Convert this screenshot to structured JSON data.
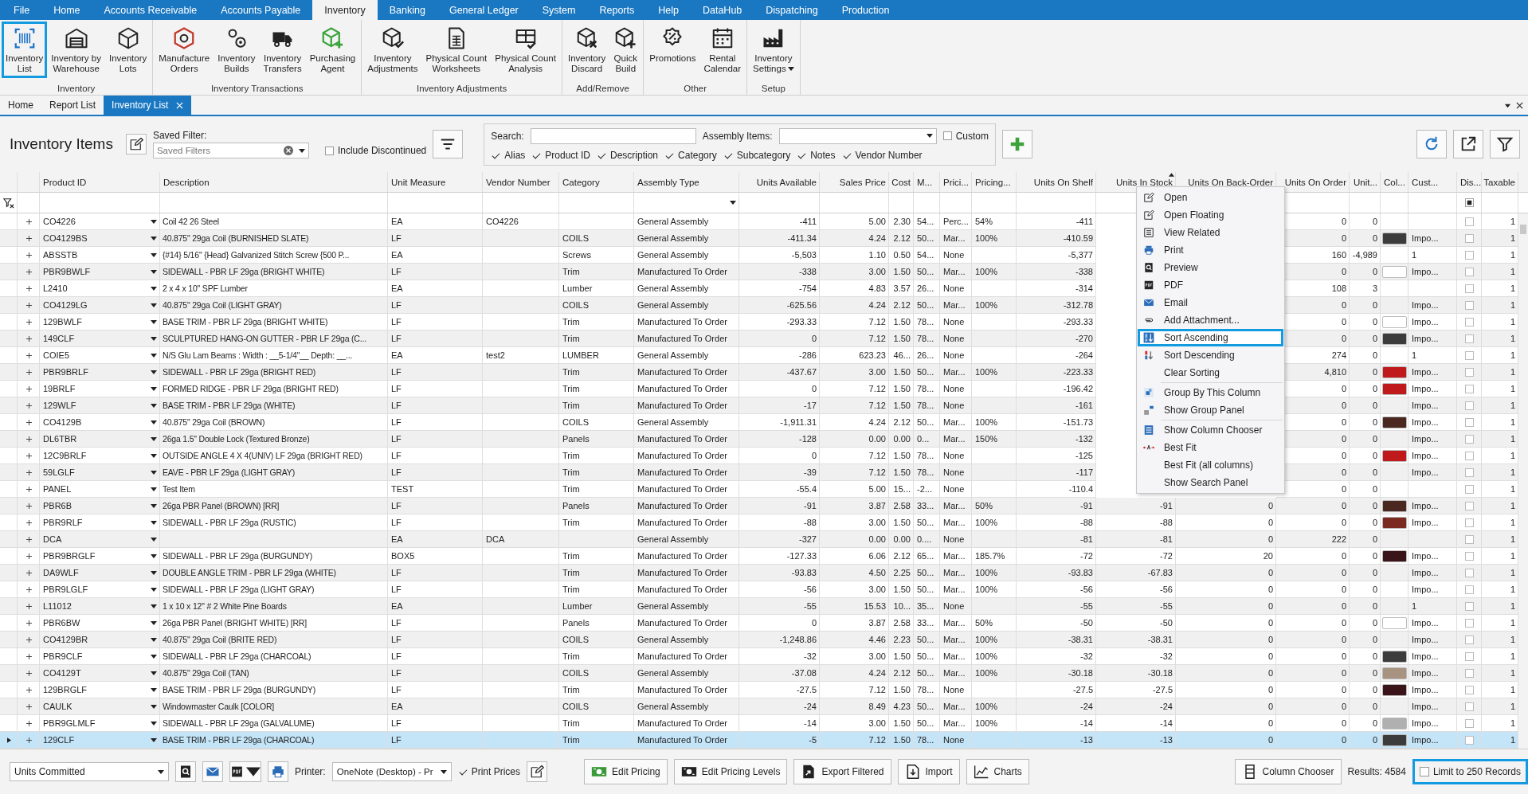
{
  "menu_tabs": [
    {
      "label": "File",
      "selected": false
    },
    {
      "label": "Home",
      "selected": false
    },
    {
      "label": "Accounts Receivable",
      "selected": false
    },
    {
      "label": "Accounts Payable",
      "selected": false
    },
    {
      "label": "Inventory",
      "selected": true
    },
    {
      "label": "Banking",
      "selected": false
    },
    {
      "label": "General Ledger",
      "selected": false
    },
    {
      "label": "System",
      "selected": false
    },
    {
      "label": "Reports",
      "selected": false
    },
    {
      "label": "Help",
      "selected": false
    },
    {
      "label": "DataHub",
      "selected": false
    },
    {
      "label": "Dispatching",
      "selected": false
    },
    {
      "label": "Production",
      "selected": false
    }
  ],
  "ribbon": [
    {
      "label": "Inventory",
      "buttons": [
        {
          "lines": [
            "Inventory",
            "List"
          ],
          "selected": true
        },
        {
          "lines": [
            "Inventory by",
            "Warehouse"
          ],
          "selected": false
        },
        {
          "lines": [
            "Inventory",
            "Lots"
          ],
          "selected": false
        }
      ]
    },
    {
      "label": "Inventory Transactions",
      "buttons": [
        {
          "lines": [
            "Manufacture",
            "Orders"
          ],
          "selected": false
        },
        {
          "lines": [
            "Inventory",
            "Builds"
          ],
          "selected": false
        },
        {
          "lines": [
            "Inventory",
            "Transfers"
          ],
          "selected": false
        },
        {
          "lines": [
            "Purchasing",
            "Agent"
          ],
          "selected": false
        }
      ]
    },
    {
      "label": "Inventory Adjustments",
      "buttons": [
        {
          "lines": [
            "Inventory",
            "Adjustments"
          ],
          "selected": false
        },
        {
          "lines": [
            "Physical Count",
            "Worksheets"
          ],
          "selected": false
        },
        {
          "lines": [
            "Physical Count",
            "Analysis"
          ],
          "selected": false
        }
      ]
    },
    {
      "label": "Add/Remove",
      "buttons": [
        {
          "lines": [
            "Inventory",
            "Discard"
          ],
          "selected": false
        },
        {
          "lines": [
            "Quick",
            "Build"
          ],
          "selected": false
        }
      ]
    },
    {
      "label": "Other",
      "buttons": [
        {
          "lines": [
            "Promotions"
          ],
          "selected": false
        },
        {
          "lines": [
            "Rental",
            "Calendar"
          ],
          "selected": false
        }
      ]
    },
    {
      "label": "Setup",
      "buttons": [
        {
          "lines": [
            "Inventory",
            "Settings"
          ],
          "selected": false,
          "dropdown": true
        }
      ]
    }
  ],
  "doc_tabs": [
    {
      "label": "Home",
      "selected": false
    },
    {
      "label": "Report List",
      "selected": false
    },
    {
      "label": "Inventory List",
      "selected": true
    }
  ],
  "toolbar": {
    "title": "Inventory Items",
    "saved_filter_label": "Saved Filter:",
    "saved_filter": {
      "placeholder": "Saved Filters"
    },
    "include_discontinued": {
      "label": "Include Discontinued",
      "checked": false
    },
    "search_label": "Search:",
    "assembly_label": "Assembly Items:",
    "custom": {
      "label": "Custom",
      "checked": false
    },
    "search_fields": [
      {
        "label": "Alias",
        "checked": true
      },
      {
        "label": "Product ID",
        "checked": true
      },
      {
        "label": "Description",
        "checked": true
      },
      {
        "label": "Category",
        "checked": true
      },
      {
        "label": "Subcategory",
        "checked": true
      },
      {
        "label": "Notes",
        "checked": true
      },
      {
        "label": "Vendor Number",
        "checked": true
      }
    ]
  },
  "table": {
    "columns": [
      {
        "label": "Product ID",
        "kind": "drop",
        "sorted": false
      },
      {
        "label": "Description",
        "kind": "desc",
        "sorted": false
      },
      {
        "label": "Unit Measure",
        "kind": "text",
        "sorted": false
      },
      {
        "label": "Vendor Number",
        "kind": "text",
        "sorted": false
      },
      {
        "label": "Category",
        "kind": "text",
        "sorted": false
      },
      {
        "label": "Assembly Type",
        "kind": "text",
        "sorted": false
      },
      {
        "label": "Units Available",
        "kind": "num",
        "sorted": false
      },
      {
        "label": "Sales Price",
        "kind": "num",
        "sorted": false
      },
      {
        "label": "Cost",
        "kind": "num",
        "sorted": false
      },
      {
        "label": "M...",
        "kind": "text",
        "sorted": false
      },
      {
        "label": "Prici...",
        "kind": "text",
        "sorted": false
      },
      {
        "label": "Pricing...",
        "kind": "text",
        "sorted": false
      },
      {
        "label": "Units On Shelf",
        "kind": "num",
        "sorted": false
      },
      {
        "label": "Units In Stock",
        "kind": "num",
        "sorted": true
      },
      {
        "label": "Units On Back-Order",
        "kind": "num",
        "sorted": false
      },
      {
        "label": "Units On Order",
        "kind": "num",
        "sorted": false
      },
      {
        "label": "Unit...",
        "kind": "num",
        "sorted": false
      },
      {
        "label": "Col...",
        "kind": "swatch",
        "sorted": false
      },
      {
        "label": "Cust...",
        "kind": "text",
        "sorted": false
      },
      {
        "label": "Dis...",
        "kind": "check",
        "sorted": false
      },
      {
        "label": "Taxable",
        "kind": "num",
        "sorted": false
      }
    ],
    "rows": [
      {
        "cells": [
          "CO4226",
          "Coil 42 26 Steel",
          "EA",
          "CO4226",
          null,
          "General Assembly",
          "-411",
          "5.00",
          "2.30",
          "54...",
          "Perc...",
          "54%",
          "-411",
          null,
          null,
          "0",
          "0",
          null,
          null,
          null,
          "1"
        ],
        "discontinued": false,
        "selected": false
      },
      {
        "cells": [
          "CO4129BS",
          "40.875\" 29ga Coil (BURNISHED SLATE)",
          "LF",
          null,
          "COILS",
          "General Assembly",
          "-411.34",
          "4.24",
          "2.12",
          "50...",
          "Mar...",
          "100%",
          "-410.59",
          null,
          null,
          "0",
          "0",
          null,
          "Impo...",
          null,
          "1"
        ],
        "color": "#3c3c3c",
        "discontinued": false,
        "selected": false
      },
      {
        "cells": [
          "ABSSTB",
          "{#14} 5/16\" {Head} Galvanized Stitch Screw {500 P...",
          "EA",
          null,
          "Screws",
          "General Assembly",
          "-5,503",
          "1.10",
          "0.50",
          "54...",
          "None",
          null,
          "-5,377",
          null,
          null,
          "160",
          "-4,989",
          null,
          "1",
          null,
          "1"
        ],
        "discontinued": false,
        "selected": false
      },
      {
        "cells": [
          "PBR9BWLF",
          "SIDEWALL - PBR LF 29ga (BRIGHT WHITE)",
          "LF",
          null,
          "Trim",
          "Manufactured To Order",
          "-338",
          "3.00",
          "1.50",
          "50...",
          "Mar...",
          "100%",
          "-338",
          null,
          null,
          "0",
          "0",
          null,
          "Impo...",
          null,
          "1"
        ],
        "color": "#ffffff",
        "discontinued": false,
        "selected": false
      },
      {
        "cells": [
          "L2410",
          "2 x 4 x 10'' SPF Lumber",
          "EA",
          null,
          "Lumber",
          "General Assembly",
          "-754",
          "4.83",
          "3.57",
          "26...",
          "None",
          null,
          "-314",
          null,
          null,
          "108",
          "3",
          null,
          null,
          null,
          "1"
        ],
        "discontinued": false,
        "selected": false
      },
      {
        "cells": [
          "CO4129LG",
          "40.875\" 29ga Coil (LIGHT GRAY)",
          "LF",
          null,
          "COILS",
          "General Assembly",
          "-625.56",
          "4.24",
          "2.12",
          "50...",
          "Mar...",
          "100%",
          "-312.78",
          null,
          null,
          "0",
          "0",
          null,
          "Impo...",
          null,
          "1"
        ],
        "discontinued": false,
        "selected": false
      },
      {
        "cells": [
          "129BWLF",
          "BASE TRIM - PBR LF 29ga (BRIGHT WHITE)",
          "LF",
          null,
          "Trim",
          "Manufactured To Order",
          "-293.33",
          "7.12",
          "1.50",
          "78...",
          "None",
          null,
          "-293.33",
          null,
          null,
          "0",
          "0",
          null,
          "Impo...",
          null,
          "1"
        ],
        "color": "#ffffff",
        "discontinued": false,
        "selected": false
      },
      {
        "cells": [
          "149CLF",
          "SCULPTURED HANG-ON GUTTER - PBR LF 29ga (C...",
          "LF",
          null,
          "Trim",
          "Manufactured To Order",
          "0",
          "7.12",
          "1.50",
          "78...",
          "None",
          null,
          "-270",
          null,
          null,
          "0",
          "0",
          null,
          "Impo...",
          null,
          "1"
        ],
        "color": "#3c3c3c",
        "discontinued": false,
        "selected": false
      },
      {
        "cells": [
          "COIE5",
          "N/S Glu Lam Beams : Width : __5-1/4\"__ Depth: __...",
          "EA",
          "test2",
          "LUMBER",
          "General Assembly",
          "-286",
          "623.23",
          "46...",
          "26...",
          "None",
          null,
          "-264",
          null,
          null,
          "274",
          "0",
          null,
          "1",
          null,
          "1"
        ],
        "discontinued": false,
        "selected": false
      },
      {
        "cells": [
          "PBR9BRLF",
          "SIDEWALL - PBR LF 29ga (BRIGHT RED)",
          "LF",
          null,
          "Trim",
          "Manufactured To Order",
          "-437.67",
          "3.00",
          "1.50",
          "50...",
          "Mar...",
          "100%",
          "-223.33",
          null,
          null,
          "4,810",
          "0",
          null,
          "Impo...",
          null,
          "1"
        ],
        "color": "#c0191c",
        "discontinued": false,
        "selected": false
      },
      {
        "cells": [
          "19BRLF",
          "FORMED RIDGE - PBR LF 29ga (BRIGHT RED)",
          "LF",
          null,
          "Trim",
          "Manufactured To Order",
          "0",
          "7.12",
          "1.50",
          "78...",
          "None",
          null,
          "-196.42",
          null,
          null,
          "0",
          "0",
          null,
          "Impo...",
          null,
          "1"
        ],
        "color": "#c0191c",
        "discontinued": false,
        "selected": false
      },
      {
        "cells": [
          "129WLF",
          "BASE TRIM - PBR LF 29ga (WHITE)",
          "LF",
          null,
          "Trim",
          "Manufactured To Order",
          "-17",
          "7.12",
          "1.50",
          "78...",
          "None",
          null,
          "-161",
          null,
          null,
          "0",
          "0",
          null,
          "Impo...",
          null,
          "1"
        ],
        "discontinued": false,
        "selected": false
      },
      {
        "cells": [
          "CO4129B",
          "40.875\" 29ga Coil (BROWN)",
          "LF",
          null,
          "COILS",
          "General Assembly",
          "-1,911.31",
          "4.24",
          "2.12",
          "50...",
          "Mar...",
          "100%",
          "-151.73",
          null,
          null,
          "0",
          "0",
          null,
          "Impo...",
          null,
          "1"
        ],
        "color": "#4a2820",
        "discontinued": false,
        "selected": false
      },
      {
        "cells": [
          "DL6TBR",
          "26ga 1.5\" Double Lock (Textured Bronze)",
          "LF",
          null,
          "Panels",
          "Manufactured To Order",
          "-128",
          "0.00",
          "0.00",
          "0...",
          "Mar...",
          "150%",
          "-132",
          null,
          null,
          "0",
          "0",
          null,
          "Impo...",
          null,
          "1"
        ],
        "discontinued": false,
        "selected": false
      },
      {
        "cells": [
          "12C9BRLF",
          "OUTSIDE ANGLE  4 X 4(UNIV) LF 29ga (BRIGHT RED)",
          "LF",
          null,
          "Trim",
          "Manufactured To Order",
          "0",
          "7.12",
          "1.50",
          "78...",
          "None",
          null,
          "-125",
          null,
          null,
          "0",
          "0",
          null,
          "Impo...",
          null,
          "1"
        ],
        "color": "#c0191c",
        "discontinued": false,
        "selected": false
      },
      {
        "cells": [
          "59LGLF",
          "EAVE - PBR LF 29ga (LIGHT GRAY)",
          "LF",
          null,
          "Trim",
          "Manufactured To Order",
          "-39",
          "7.12",
          "1.50",
          "78...",
          "None",
          null,
          "-117",
          null,
          null,
          "0",
          "0",
          null,
          "Impo...",
          null,
          "1"
        ],
        "discontinued": false,
        "selected": false
      },
      {
        "cells": [
          "PANEL",
          "Test Item",
          "TEST",
          null,
          "Trim",
          "Manufactured To Order",
          "-55.4",
          "5.00",
          "15...",
          "-2...",
          "None",
          null,
          "-110.4",
          null,
          null,
          "0",
          "0",
          null,
          null,
          null,
          "1"
        ],
        "discontinued": false,
        "selected": false
      },
      {
        "cells": [
          "PBR6B",
          "26ga PBR Panel (BROWN) [RR]",
          "LF",
          null,
          "Panels",
          "Manufactured To Order",
          "-91",
          "3.87",
          "2.58",
          "33...",
          "Mar...",
          "50%",
          "-91",
          "-91",
          "0",
          "0",
          "0",
          null,
          "Impo...",
          null,
          "1"
        ],
        "color": "#4a2820",
        "discontinued": false,
        "selected": false
      },
      {
        "cells": [
          "PBR9RLF",
          "SIDEWALL - PBR LF 29ga (RUSTIC)",
          "LF",
          null,
          "Trim",
          "Manufactured To Order",
          "-88",
          "3.00",
          "1.50",
          "50...",
          "Mar...",
          "100%",
          "-88",
          "-88",
          "0",
          "0",
          "0",
          null,
          "Impo...",
          null,
          "1"
        ],
        "color": "#7a2a1e",
        "discontinued": false,
        "selected": false
      },
      {
        "cells": [
          "DCA",
          null,
          "EA",
          "DCA",
          null,
          "General Assembly",
          "-327",
          "0.00",
          "0.00",
          "0....",
          "None",
          null,
          "-81",
          "-81",
          "0",
          "222",
          "0",
          null,
          null,
          null,
          "1"
        ],
        "discontinued": false,
        "selected": false
      },
      {
        "cells": [
          "PBR9BRGLF",
          "SIDEWALL - PBR LF 29ga (BURGUNDY)",
          "BOX5",
          null,
          "Trim",
          "Manufactured To Order",
          "-127.33",
          "6.06",
          "2.12",
          "65...",
          "Mar...",
          "185.7%",
          "-72",
          "-72",
          "20",
          "0",
          "0",
          null,
          "Impo...",
          null,
          "1"
        ],
        "color": "#3a1418",
        "discontinued": false,
        "selected": false
      },
      {
        "cells": [
          "DA9WLF",
          "DOUBLE ANGLE TRIM - PBR LF 29ga (WHITE)",
          "LF",
          null,
          "Trim",
          "Manufactured To Order",
          "-93.83",
          "4.50",
          "2.25",
          "50...",
          "Mar...",
          "100%",
          "-93.83",
          "-67.83",
          "0",
          "0",
          "0",
          null,
          "Impo...",
          null,
          "1"
        ],
        "discontinued": false,
        "selected": false
      },
      {
        "cells": [
          "PBR9LGLF",
          "SIDEWALL - PBR LF 29ga (LIGHT GRAY)",
          "LF",
          null,
          "Trim",
          "Manufactured To Order",
          "-56",
          "3.00",
          "1.50",
          "50...",
          "Mar...",
          "100%",
          "-56",
          "-56",
          "0",
          "0",
          "0",
          null,
          "Impo...",
          null,
          "1"
        ],
        "discontinued": false,
        "selected": false
      },
      {
        "cells": [
          "L11012",
          "1 x 10 x 12'' # 2 White Pine Boards",
          "EA",
          null,
          "Lumber",
          "General Assembly",
          "-55",
          "15.53",
          "10...",
          "35...",
          "None",
          null,
          "-55",
          "-55",
          "0",
          "0",
          "0",
          null,
          "1",
          null,
          "1"
        ],
        "discontinued": false,
        "selected": false
      },
      {
        "cells": [
          "PBR6BW",
          "26ga PBR Panel (BRIGHT WHITE) [RR]",
          "LF",
          null,
          "Panels",
          "Manufactured To Order",
          "0",
          "3.87",
          "2.58",
          "33...",
          "Mar...",
          "50%",
          "-50",
          "-50",
          "0",
          "0",
          "0",
          null,
          "Impo...",
          null,
          "1"
        ],
        "color": "#ffffff",
        "discontinued": false,
        "selected": false
      },
      {
        "cells": [
          "CO4129BR",
          "40.875\" 29ga Coil (BRITE RED)",
          "LF",
          null,
          "COILS",
          "General Assembly",
          "-1,248.86",
          "4.46",
          "2.23",
          "50...",
          "Mar...",
          "100%",
          "-38.31",
          "-38.31",
          "0",
          "0",
          "0",
          null,
          "Impo...",
          null,
          "1"
        ],
        "discontinued": false,
        "selected": false
      },
      {
        "cells": [
          "PBR9CLF",
          "SIDEWALL - PBR LF 29ga (CHARCOAL)",
          "LF",
          null,
          "Trim",
          "Manufactured To Order",
          "-32",
          "3.00",
          "1.50",
          "50...",
          "Mar...",
          "100%",
          "-32",
          "-32",
          "0",
          "0",
          "0",
          null,
          "Impo...",
          null,
          "1"
        ],
        "color": "#3c3c3c",
        "discontinued": false,
        "selected": false
      },
      {
        "cells": [
          "CO4129T",
          "40.875\" 29ga Coil (TAN)",
          "LF",
          null,
          "COILS",
          "General Assembly",
          "-37.08",
          "4.24",
          "2.12",
          "50...",
          "Mar...",
          "100%",
          "-30.18",
          "-30.18",
          "0",
          "0",
          "0",
          null,
          "Impo...",
          null,
          "1"
        ],
        "color": "#a89280",
        "discontinued": false,
        "selected": false
      },
      {
        "cells": [
          "129BRGLF",
          "BASE TRIM - PBR LF 29ga (BURGUNDY)",
          "LF",
          null,
          "Trim",
          "Manufactured To Order",
          "-27.5",
          "7.12",
          "1.50",
          "78...",
          "None",
          null,
          "-27.5",
          "-27.5",
          "0",
          "0",
          "0",
          null,
          "Impo...",
          null,
          "1"
        ],
        "color": "#3a1418",
        "discontinued": false,
        "selected": false
      },
      {
        "cells": [
          "CAULK",
          "Windowmaster Caulk [COLOR]",
          "EA",
          null,
          "COILS",
          "General Assembly",
          "-24",
          "8.49",
          "4.23",
          "50...",
          "Mar...",
          "100%",
          "-24",
          "-24",
          "0",
          "0",
          "0",
          null,
          "Impo...",
          null,
          "1"
        ],
        "discontinued": false,
        "selected": false
      },
      {
        "cells": [
          "PBR9GLMLF",
          "SIDEWALL - PBR LF 29ga (GALVALUME)",
          "LF",
          null,
          "Trim",
          "Manufactured To Order",
          "-14",
          "3.00",
          "1.50",
          "50...",
          "Mar...",
          "100%",
          "-14",
          "-14",
          "0",
          "0",
          "0",
          null,
          "Impo...",
          null,
          "1"
        ],
        "color": "#b0b0b0",
        "discontinued": false,
        "selected": false
      },
      {
        "cells": [
          "129CLF",
          "BASE TRIM - PBR LF 29ga (CHARCOAL)",
          "LF",
          null,
          "Trim",
          "Manufactured To Order",
          "-5",
          "7.12",
          "1.50",
          "78...",
          "None",
          null,
          "-13",
          "-13",
          "0",
          "0",
          "0",
          null,
          "Impo...",
          null,
          "1"
        ],
        "color": "#3c3c3c",
        "discontinued": false,
        "selected": true
      }
    ]
  },
  "context_menu": [
    [
      {
        "label": "Open",
        "selected": false
      },
      {
        "label": "Open Floating",
        "selected": false
      },
      {
        "label": "View Related",
        "selected": false
      },
      {
        "label": "Print",
        "selected": false
      },
      {
        "label": "Preview",
        "selected": false
      },
      {
        "label": "PDF",
        "selected": false
      },
      {
        "label": "Email",
        "selected": false
      },
      {
        "label": "Add Attachment...",
        "selected": false
      },
      {
        "label": "Sort Ascending",
        "selected": true
      },
      {
        "label": "Sort Descending",
        "selected": false
      },
      {
        "label": "Clear Sorting",
        "selected": false
      }
    ],
    [
      {
        "label": "Group By This Column",
        "selected": false
      },
      {
        "label": "Show Group Panel",
        "selected": false
      }
    ],
    [
      {
        "label": "Show Column Chooser",
        "selected": false
      },
      {
        "label": "Best Fit",
        "selected": false
      },
      {
        "label": "Best Fit (all columns)",
        "selected": false
      },
      {
        "label": "Show Search Panel",
        "selected": false
      }
    ]
  ],
  "bottom": {
    "view_select": {
      "value": "Units Committed"
    },
    "printer_label": "Printer:",
    "printer_select": {
      "value": "OneNote (Desktop) - Pr"
    },
    "print_prices": {
      "label": "Print Prices",
      "checked": true
    },
    "actions": [
      {
        "label": "Edit Pricing"
      },
      {
        "label": "Edit Pricing Levels"
      },
      {
        "label": "Export Filtered"
      },
      {
        "label": "Import"
      },
      {
        "label": "Charts"
      }
    ],
    "column_chooser": "Column Chooser",
    "results": "Results: 4584",
    "limit": {
      "label": "Limit to 250 Records",
      "checked": false,
      "highlighted": true
    }
  }
}
